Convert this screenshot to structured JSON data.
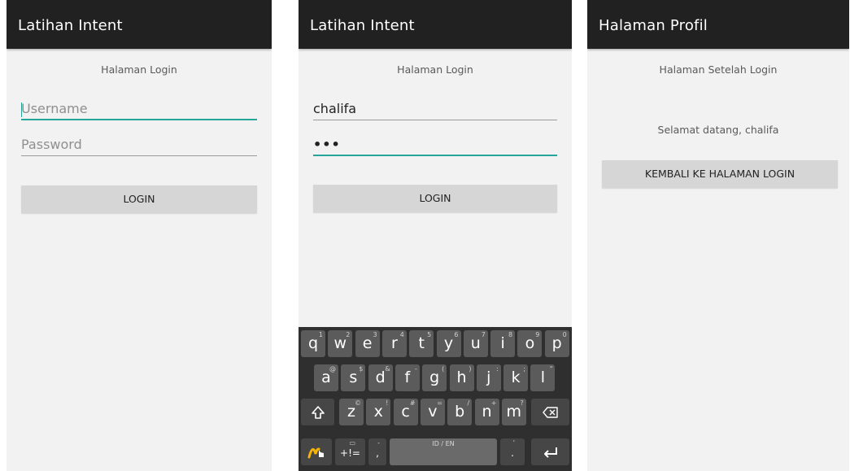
{
  "screens": [
    {
      "title": "Latihan Intent",
      "subtitle": "Halaman Login",
      "username_placeholder": "Username",
      "password_placeholder": "Password",
      "login_label": "LOGIN"
    },
    {
      "title": "Latihan Intent",
      "subtitle": "Halaman Login",
      "username_value": "chalifa",
      "password_value": "•••",
      "login_label": "LOGIN"
    },
    {
      "title": "Halaman Profil",
      "subtitle": "Halaman Setelah Login",
      "welcome_text": "Selamat datang, chalifa",
      "back_label": "KEMBALI KE HALAMAN LOGIN"
    }
  ],
  "keyboard": {
    "row1": [
      {
        "k": "q",
        "h": "1"
      },
      {
        "k": "w",
        "h": "2"
      },
      {
        "k": "e",
        "h": "3"
      },
      {
        "k": "r",
        "h": "4"
      },
      {
        "k": "t",
        "h": "5"
      },
      {
        "k": "y",
        "h": "6"
      },
      {
        "k": "u",
        "h": "7"
      },
      {
        "k": "i",
        "h": "8"
      },
      {
        "k": "o",
        "h": "9"
      },
      {
        "k": "p",
        "h": "0"
      }
    ],
    "row2": [
      {
        "k": "a",
        "h": "@"
      },
      {
        "k": "s",
        "h": "$"
      },
      {
        "k": "d",
        "h": "&"
      },
      {
        "k": "f",
        "h": "-"
      },
      {
        "k": "g",
        "h": "("
      },
      {
        "k": "h",
        "h": ")"
      },
      {
        "k": "j",
        "h": ":"
      },
      {
        "k": "k",
        "h": ";"
      },
      {
        "k": "l",
        "h": "\""
      }
    ],
    "row3": [
      {
        "k": "z",
        "h": "©"
      },
      {
        "k": "x",
        "h": "!"
      },
      {
        "k": "c",
        "h": "#"
      },
      {
        "k": "v",
        "h": "="
      },
      {
        "k": "b",
        "h": "/"
      },
      {
        "k": "n",
        "h": "+"
      },
      {
        "k": "m",
        "h": "?"
      }
    ],
    "shift_icon": "shift-arrow-icon",
    "backspace_icon": "backspace-icon",
    "swype_icon": "swype-hand-icon",
    "symbols_label": "+!=",
    "comma_label": ",",
    "comma_hint": "-",
    "space_label": "ID / EN",
    "period_label": ".",
    "period_hint": "'",
    "enter_icon": "enter-arrow-icon"
  },
  "colors": {
    "appbar": "#212121",
    "accent": "#26a69a",
    "screen_bg": "#f2f2f2",
    "button_bg": "#d6d6d6",
    "keyboard_bg": "#2f2f2f",
    "key_bg": "#5b5b5b"
  }
}
